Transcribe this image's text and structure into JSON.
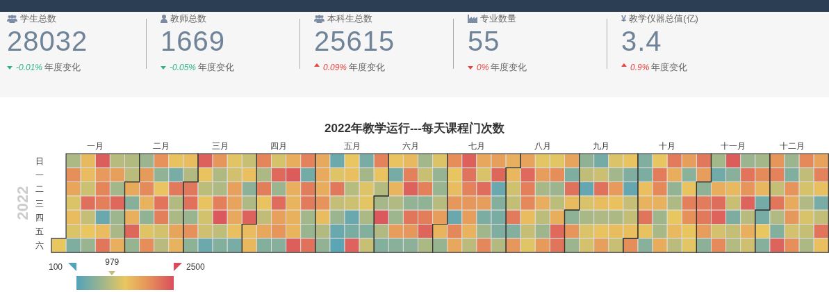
{
  "stats": [
    {
      "kind": "users",
      "label": "学生总数",
      "value": "28032",
      "change": {
        "kind": "down",
        "color": "#2db38a",
        "text": "-0.01%"
      },
      "change_label": "年度变化"
    },
    {
      "kind": "user",
      "label": "教师总数",
      "value": "1669",
      "change": {
        "kind": "down",
        "color": "#2db38a",
        "text": "-0.05%"
      },
      "change_label": "年度变化"
    },
    {
      "kind": "users",
      "label": "本科生总数",
      "value": "25615",
      "change": {
        "kind": "up",
        "color": "#e8433f",
        "text": "0.09%"
      },
      "change_label": "年度变化"
    },
    {
      "kind": "chart",
      "label": "专业数量",
      "value": "55",
      "change": {
        "kind": "down",
        "color": "#e8433f",
        "text": "0%"
      },
      "change_label": "年度变化"
    },
    {
      "kind": "char",
      "icon_char": "¥",
      "label": "教学仪器总值(亿)",
      "value": "3.4",
      "change": {
        "kind": "up",
        "color": "#e8433f",
        "text": "0.9%"
      },
      "change_label": "年度变化"
    }
  ],
  "calendar": {
    "title": "2022年教学运行---每天课程门次数",
    "year_label": "2022",
    "months": [
      "一月",
      "二月",
      "三月",
      "四月",
      "五月",
      "六月",
      "七月",
      "八月",
      "九月",
      "十月",
      "十一月",
      "十二月"
    ],
    "weekdays": [
      "日",
      "一",
      "二",
      "三",
      "四",
      "五",
      "六"
    ],
    "legend": {
      "min": "100",
      "max": "2500",
      "pointer": {
        "label": "979",
        "level": 0.366
      }
    }
  }
}
